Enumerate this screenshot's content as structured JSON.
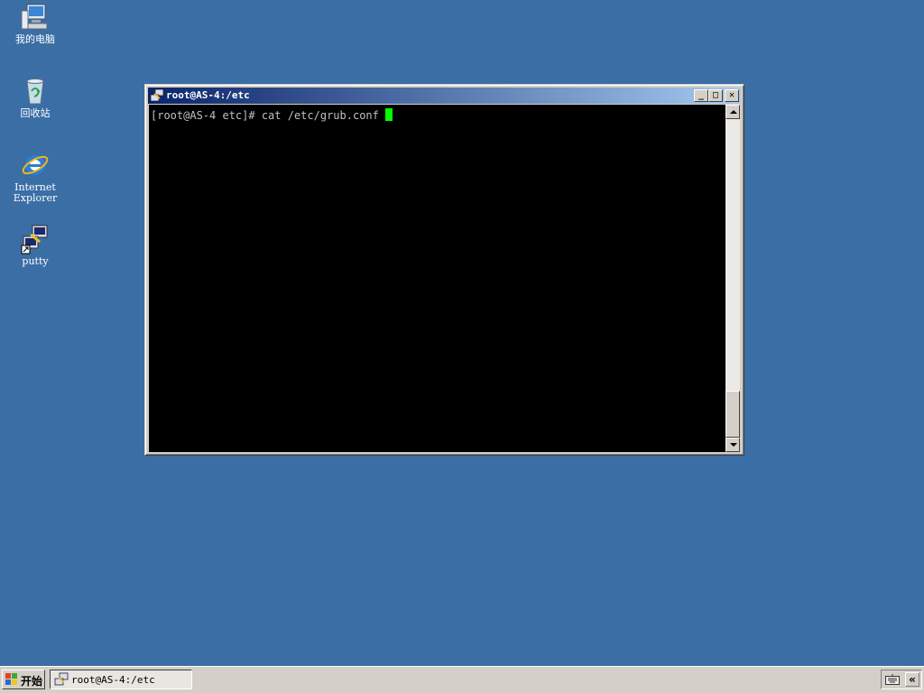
{
  "desktop": {
    "icons": [
      {
        "label": "我的电脑",
        "icon": "my-computer-icon"
      },
      {
        "label": "回收站",
        "icon": "recycle-bin-icon"
      },
      {
        "label": "Internet\nExplorer",
        "icon": "internet-explorer-icon"
      },
      {
        "label": "putty",
        "icon": "putty-icon"
      }
    ],
    "background_color": "#3a6ea5"
  },
  "window": {
    "title": "root@AS-4:/etc",
    "icon": "putty-icon",
    "buttons": {
      "minimize": "_",
      "maximize": "□",
      "close": "✕"
    },
    "terminal": {
      "prompt_line": "[root@AS-4 etc]# cat /etc/grub.conf ",
      "cursor_color": "#00ff00"
    }
  },
  "taskbar": {
    "start_label": "开始",
    "tasks": [
      {
        "label": "root@AS-4:/etc",
        "icon": "putty-icon"
      }
    ],
    "tray": {
      "keyboard_icon": "keyboard-icon",
      "expand_label": "«"
    }
  }
}
